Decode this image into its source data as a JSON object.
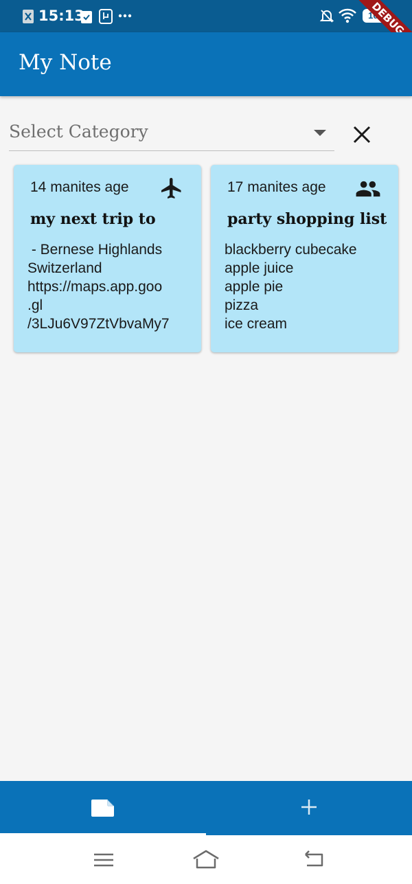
{
  "status_bar": {
    "time": "15:13",
    "battery": "100",
    "debug_label": "DEBUG"
  },
  "app_bar": {
    "title": "My Note"
  },
  "filter": {
    "placeholder": "Select Category"
  },
  "notes": [
    {
      "time": "14 manites age",
      "category_icon": "airplane-icon",
      "title": "my next trip to",
      "body_lines": [
        " - Bernese Highlands",
        "Switzerland",
        "https://maps.app.goo",
        ".gl",
        "/3LJu6V97ZtVbvaMy7"
      ]
    },
    {
      "time": "17 manites age",
      "category_icon": "people-icon",
      "title": "party shopping list",
      "body_lines": [
        "blackberry cubecake",
        "apple juice",
        "apple pie",
        "pizza",
        "ice cream"
      ]
    }
  ],
  "bottom_nav": {
    "items": [
      {
        "icon": "note-icon",
        "selected": true
      },
      {
        "icon": "add-icon",
        "selected": false
      }
    ]
  },
  "colors": {
    "status_bar": "#0a5c91",
    "primary": "#0a72b8",
    "card": "#b3e5f8",
    "background": "#f5f5f5"
  }
}
